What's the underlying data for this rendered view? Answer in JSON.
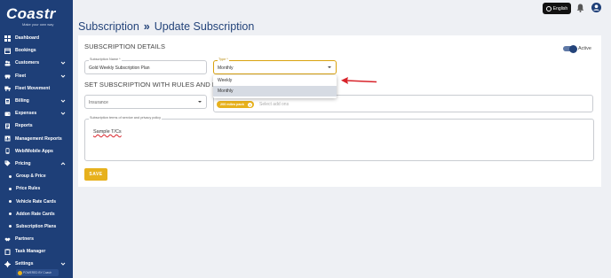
{
  "brand": {
    "name": "Coastr",
    "tagline": "Make your own way"
  },
  "sidebar": {
    "items": [
      {
        "label": "Dashboard",
        "icon": "dashboard-icon",
        "chevron": false
      },
      {
        "label": "Bookings",
        "icon": "calendar-icon",
        "chevron": false
      },
      {
        "label": "Customers",
        "icon": "users-icon",
        "chevron": true
      },
      {
        "label": "Fleet",
        "icon": "car-icon",
        "chevron": true
      },
      {
        "label": "Fleet Movement",
        "icon": "truck-icon",
        "chevron": false
      },
      {
        "label": "Billing",
        "icon": "billing-icon",
        "chevron": true
      },
      {
        "label": "Expenses",
        "icon": "wallet-icon",
        "chevron": true
      },
      {
        "label": "Reports",
        "icon": "report-icon",
        "chevron": false
      },
      {
        "label": "Management Reports",
        "icon": "chart-icon",
        "chevron": false
      },
      {
        "label": "Web/Mobile Apps",
        "icon": "mobile-icon",
        "chevron": false
      },
      {
        "label": "Pricing",
        "icon": "tag-icon",
        "chevron": true,
        "expanded": true
      }
    ],
    "pricing_sub": [
      {
        "label": "Group & Price"
      },
      {
        "label": "Price Rules"
      },
      {
        "label": "Vehicle Rate Cards"
      },
      {
        "label": "Addon Rate Cards"
      },
      {
        "label": "Subscription Plans"
      }
    ],
    "bottom_items": [
      {
        "label": "Partners",
        "icon": "handshake-icon",
        "chevron": false
      },
      {
        "label": "Task Manager",
        "icon": "clipboard-icon",
        "chevron": false
      },
      {
        "label": "Settings",
        "icon": "gear-icon",
        "chevron": true
      }
    ],
    "powered_by": "POWERED BY Coastr"
  },
  "topbar": {
    "language": "English"
  },
  "breadcrumb": {
    "parent": "Subscription",
    "separator": "»",
    "current": "Update Subscription"
  },
  "details": {
    "title": "SUBSCRIPTION DETAILS",
    "active_label": "Active",
    "active": true,
    "name_label": "Subscription Name *",
    "name_value": "Gold Weekly Subscription Plan",
    "type_label": "Type *",
    "type_value": "Monthly",
    "type_options": [
      "Weekly",
      "Monthly"
    ],
    "type_selected": "Monthly"
  },
  "rules": {
    "title": "SET SUBSCRIPTION WITH RULES AND FEATURES",
    "insurance_value": "Insurance",
    "chip_label": "200 miles pack",
    "add_placeholder": "Select add ons",
    "terms_label": "Subscription terms of service and privacy policy",
    "terms_value": "Sample T/Cs"
  },
  "actions": {
    "save_label": "SAVE"
  },
  "colors": {
    "sidebar": "#1e3f78",
    "accent": "#e7b11d",
    "arrow": "#d8232a",
    "title": "#24447a"
  }
}
